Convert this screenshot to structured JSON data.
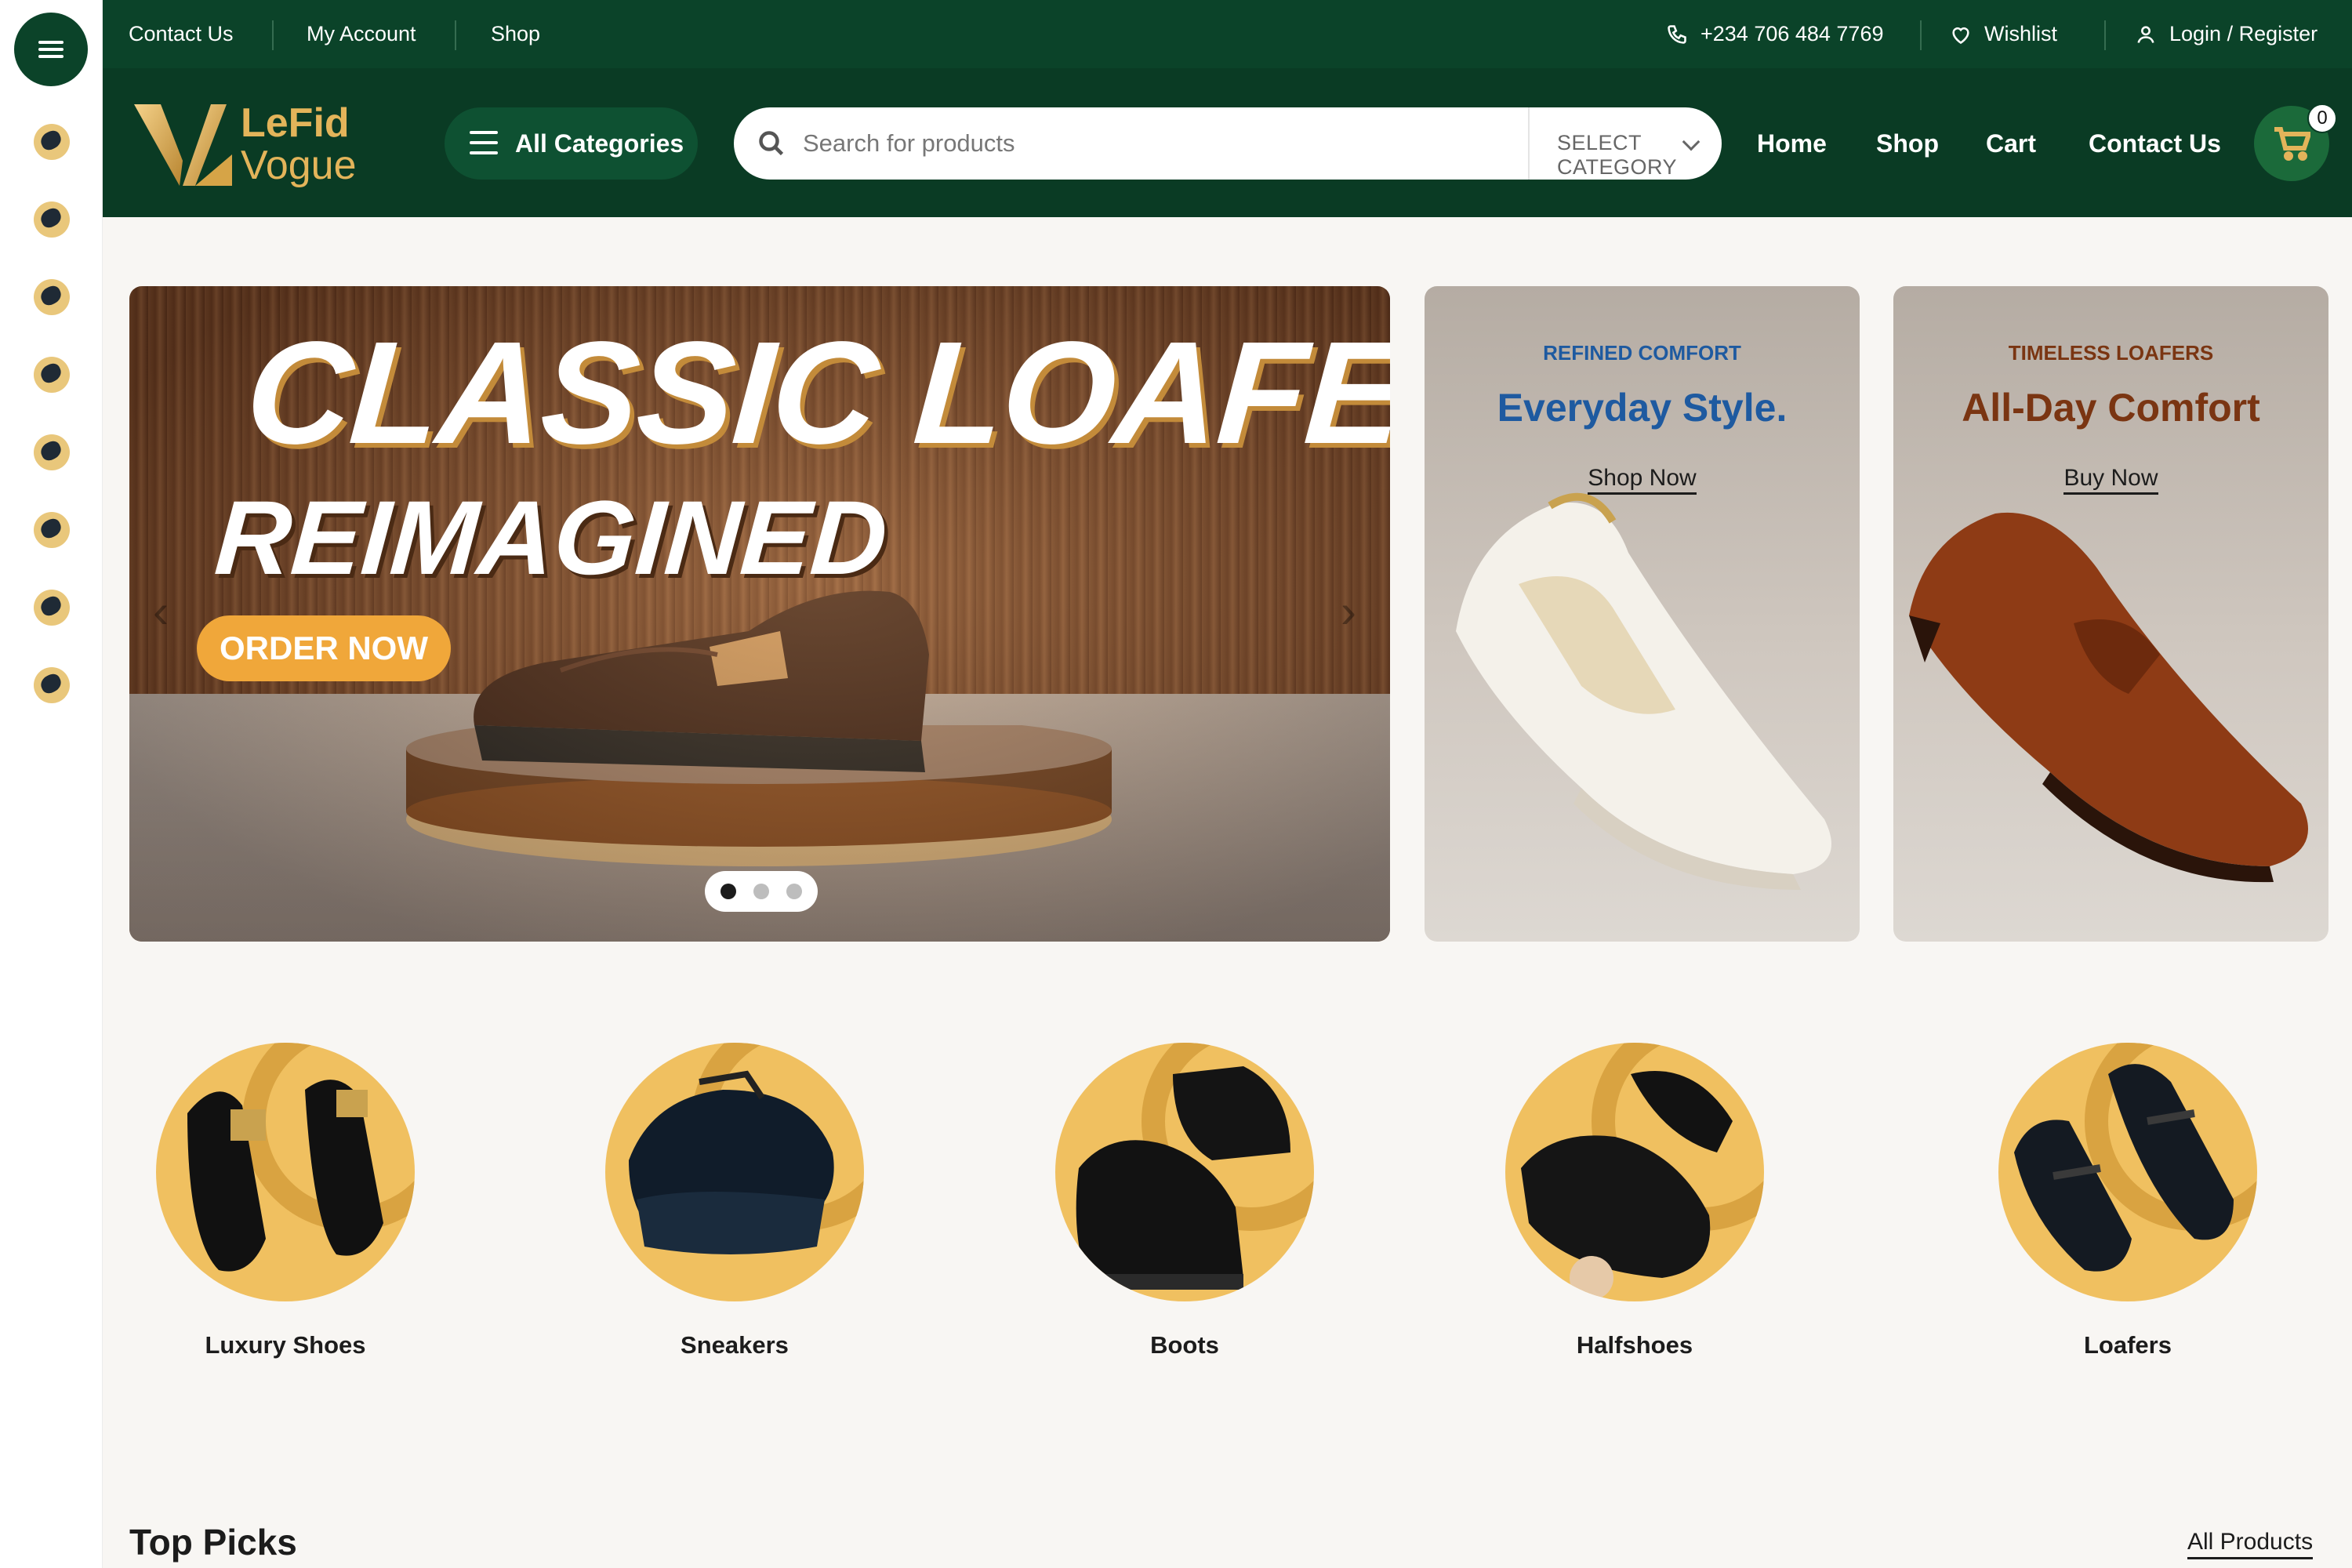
{
  "topbar": {
    "links": [
      "Contact Us",
      "My Account",
      "Shop"
    ],
    "phone": "+234 706 484 7769",
    "wishlist": "Wishlist",
    "login": "Login / Register"
  },
  "brand": {
    "line1": "LeFid",
    "line2": "Vogue"
  },
  "header": {
    "categories_button": "All Categories",
    "search_placeholder": "Search for products",
    "category_select": "SELECT CATEGORY",
    "nav": [
      "Home",
      "Shop",
      "Cart",
      "Contact Us"
    ],
    "cart_count": "0"
  },
  "hero": {
    "title_line1": "CLASSIC LOAFERS",
    "title_line2": "REIMAGINED",
    "cta": "ORDER NOW",
    "prev_arrow": "‹",
    "next_arrow": "›",
    "slides_total": 3,
    "slide_active": 1
  },
  "banners": [
    {
      "kicker": "REFINED COMFORT",
      "headline": "Everyday Style.",
      "cta": "Shop Now",
      "accent": "#1e5aa0"
    },
    {
      "kicker": "TIMELESS LOAFERS",
      "headline": "All-Day Comfort",
      "cta": "Buy Now",
      "accent": "#7a3512"
    }
  ],
  "categories": [
    "Luxury Shoes",
    "Sneakers",
    "Boots",
    "Halfshoes",
    "Loafers"
  ],
  "section": {
    "title": "Top Picks",
    "link": "All Products"
  },
  "colors": {
    "brand_dark": "#0a3b24",
    "brand_green": "#0b4329",
    "gold": "#e3b45a",
    "category_circle": "#f0c060"
  }
}
